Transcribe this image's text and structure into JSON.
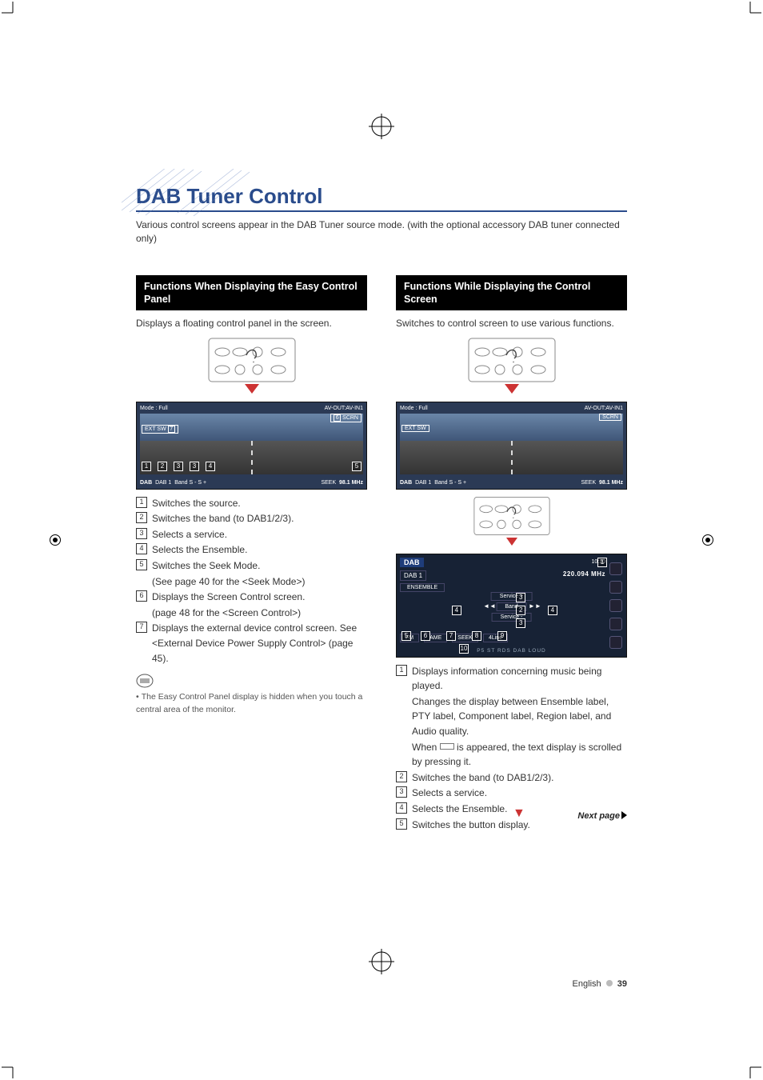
{
  "page": {
    "title": "DAB Tuner Control",
    "intro": "Various control screens appear in the DAB Tuner source mode. (with the optional accessory DAB tuner connected only)",
    "footer_lang": "English",
    "footer_page": "39",
    "next_page": "Next page"
  },
  "left": {
    "heading": "Functions When Displaying the Easy Control Panel",
    "subtitle": "Displays a floating control panel in the screen.",
    "screenshot": {
      "mode": "Mode : Full",
      "avout": "AV-OUT:AV-IN1",
      "scrn": "SCRN",
      "extsw": "EXT SW",
      "dab": "DAB",
      "dab_sub": "DAB 1",
      "band": "Band",
      "sminus": "S -",
      "splus": "S +",
      "seek": "SEEK",
      "freq": "98.1 MHz"
    },
    "list": [
      "Switches the source.",
      "Switches the band (to DAB1/2/3).",
      "Selects a service.",
      "Selects the Ensemble.",
      "Switches the Seek Mode.",
      "Displays the Screen Control screen.",
      "Displays the external device control screen. See <External Device Power Supply Control> (page 45)."
    ],
    "list_sub": {
      "4": "(See page 40 for the <Seek Mode>)",
      "5": "(page 48 for the <Screen Control>)"
    },
    "note": "The Easy Control Panel display is hidden when you touch a central area of the monitor."
  },
  "right": {
    "heading": "Functions While Displaying the Control Screen",
    "subtitle": "Switches to control screen to use various functions.",
    "screenshot": {
      "mode": "Mode : Full",
      "avout": "AV-OUT:AV-IN1",
      "scrn": "SCRN",
      "extsw": "EXT SW",
      "dab": "DAB",
      "dab_sub": "DAB 1",
      "band": "Band",
      "sminus": "S -",
      "splus": "S +",
      "seek": "SEEK",
      "freq": "98.1 MHz"
    },
    "dab_screen": {
      "title": "DAB",
      "band": "DAB 1",
      "freq": "220.094 MHz",
      "ensemble": "ENSEMBLE",
      "btn_service_plus": "Service +",
      "btn_band": "Band",
      "btn_service_minus": "Service -",
      "btn_fm": "FM",
      "btn_ame": "AME",
      "btn_seek": "SEEK",
      "btn_4line": "4Line",
      "status": "P5   ST   RDS   DAB   LOUD",
      "time": "10:10"
    },
    "list": [
      "Displays information concerning music being played.",
      "Switches the band (to DAB1/2/3).",
      "Selects a service.",
      "Selects the Ensemble.",
      "Switches the button display."
    ],
    "list1_extra1": "Changes the display between Ensemble label, PTY label, Component label, Region label, and Audio quality.",
    "list1_extra2_a": "When ",
    "list1_extra2_b": " is appeared, the text display is scrolled by pressing it."
  }
}
